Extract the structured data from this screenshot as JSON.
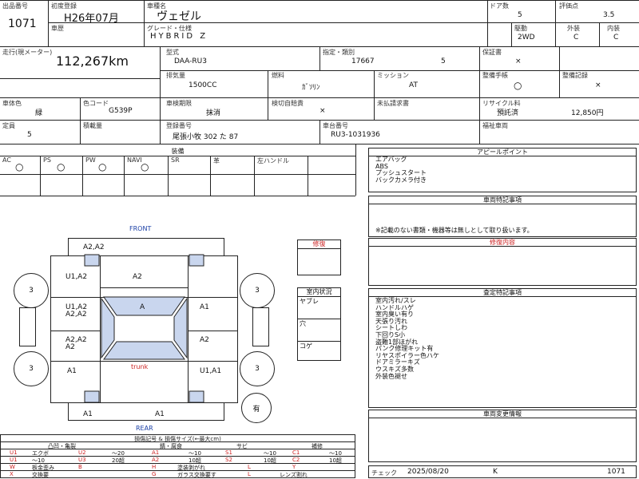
{
  "header": {
    "listing_no_label": "出品番号",
    "listing_no": "1071",
    "first_reg_label": "初度登録",
    "first_reg": "H26年07月",
    "model_name_label": "車種名",
    "model_name": "ヴェゼル",
    "doors_label": "ドア数",
    "doors": "5",
    "grade_score_label": "評価点",
    "grade_score": "3.5",
    "body_type_label": "車歴",
    "grade_label": "グレード・仕様",
    "grade": "HYBRID Z",
    "drive_label": "駆動",
    "drive": "2WD",
    "exterior_label": "外装",
    "exterior": "C",
    "interior_label": "内装",
    "interior": "C",
    "mileage_label": "走行(現メーター)",
    "mileage": "112,267km",
    "model_code_label": "型式",
    "model_code": "DAA-RU3",
    "designation_label": "指定・類別",
    "designation": "17667",
    "category": "5",
    "warranty_label": "保証書",
    "warranty": "×",
    "displacement_label": "排気量",
    "displacement": "1500CC",
    "fuel_label": "燃料",
    "fuel": "ｶﾞｿﾘﾝ",
    "mission_label": "ミッション",
    "mission": "AT",
    "manual_label": "整備手帳",
    "manual": "○",
    "maint_record_label": "整備記録",
    "maint_record": "×",
    "color_label": "車体色",
    "color": "緑",
    "color_code_label": "色コード",
    "color_code": "G539P",
    "inspection_label": "車検期限",
    "inspection": "抹消",
    "auto_inspect_label": "検切自賠責",
    "auto_inspect": "×",
    "unclaimed_label": "未払請求書",
    "recycle_label": "リサイクル料",
    "recycle_status": "預託済",
    "recycle_fee": "12,850円",
    "capacity_label": "定員",
    "capacity": "5",
    "load_label": "積載量",
    "plate_label": "登録番号",
    "plate": "尾張小牧 302 た 87",
    "chassis_label": "車台番号",
    "chassis": "RU3-1031936",
    "welfare_label": "福祉車両"
  },
  "equipment": {
    "title": "装備",
    "cols": [
      "AC",
      "PS",
      "PW",
      "NAVI",
      "SR",
      "革",
      "左ハンドル"
    ],
    "vals": [
      "○",
      "○",
      "○",
      "○",
      "",
      "",
      ""
    ]
  },
  "appeal": {
    "title": "アピールポイント",
    "lines": [
      "エアバッグ",
      "ABS",
      "プッシュスタート",
      "バックカメラ付き"
    ]
  },
  "special": {
    "title": "車両特記事項",
    "note": "※記載のない書類・機器等は無しとして取り扱います。"
  },
  "repair": {
    "title": "修復内容"
  },
  "inspection_notes": {
    "title": "査定特記事項",
    "lines": [
      "室内汚れ/スレ",
      "ハンドルハゲ",
      "室内臭い有り",
      "天張り汚れ",
      "シートしわ",
      "下回りS小",
      "盗難1部ほがれ",
      "パンク修理キット有",
      "リヤスポイラー色ハケ",
      "ドアミラーキズ",
      "ウスキズ多数",
      "外装色褪せ"
    ]
  },
  "changes": {
    "title": "車両変更情報"
  },
  "side": {
    "repair_box": "修復",
    "interior_title": "室内状況",
    "interior_items": [
      "ヤブレ",
      "穴",
      "コゲ"
    ]
  },
  "diagram": {
    "front": "FRONT",
    "rear": "REAR",
    "trunk": "trunk",
    "tire_values": [
      "3",
      "3",
      "3",
      "3"
    ],
    "spare": "有",
    "marks": [
      "A2,A2",
      "U1,A2",
      "A2",
      "U1,A2",
      "A2,A2",
      "A",
      "A1",
      "A2,A2",
      "A2",
      "A2",
      "A1",
      "U1,A1",
      "A1",
      "A1"
    ]
  },
  "legend": {
    "title": "損傷記号 & 損傷サイズ(←最大cm)",
    "head": [
      "凸凹・亀裂",
      "錆・腐食",
      "サビ",
      "補修"
    ],
    "row1": [
      "U1",
      "エクボ",
      "U2",
      "〜20",
      "A1",
      "〜10",
      "S1",
      "〜10",
      "C1",
      "〜10"
    ],
    "row2": [
      "U1",
      "〜10",
      "U3",
      "20超",
      "A2",
      "10超",
      "S2",
      "10超",
      "C2",
      "10超"
    ],
    "row3": [
      "W",
      "板金歪み",
      "B",
      "",
      "H",
      "塗装剥がれ",
      "L",
      "",
      "Y",
      "",
      "XX",
      "交換済"
    ],
    "row4": [
      "X",
      "交換要",
      "G",
      "ガラス交換要す",
      "L",
      "レンズ割れ"
    ]
  },
  "footer": {
    "check_label": "チェック",
    "date": "2025/08/20",
    "code": "K",
    "listing_no": "1071"
  }
}
